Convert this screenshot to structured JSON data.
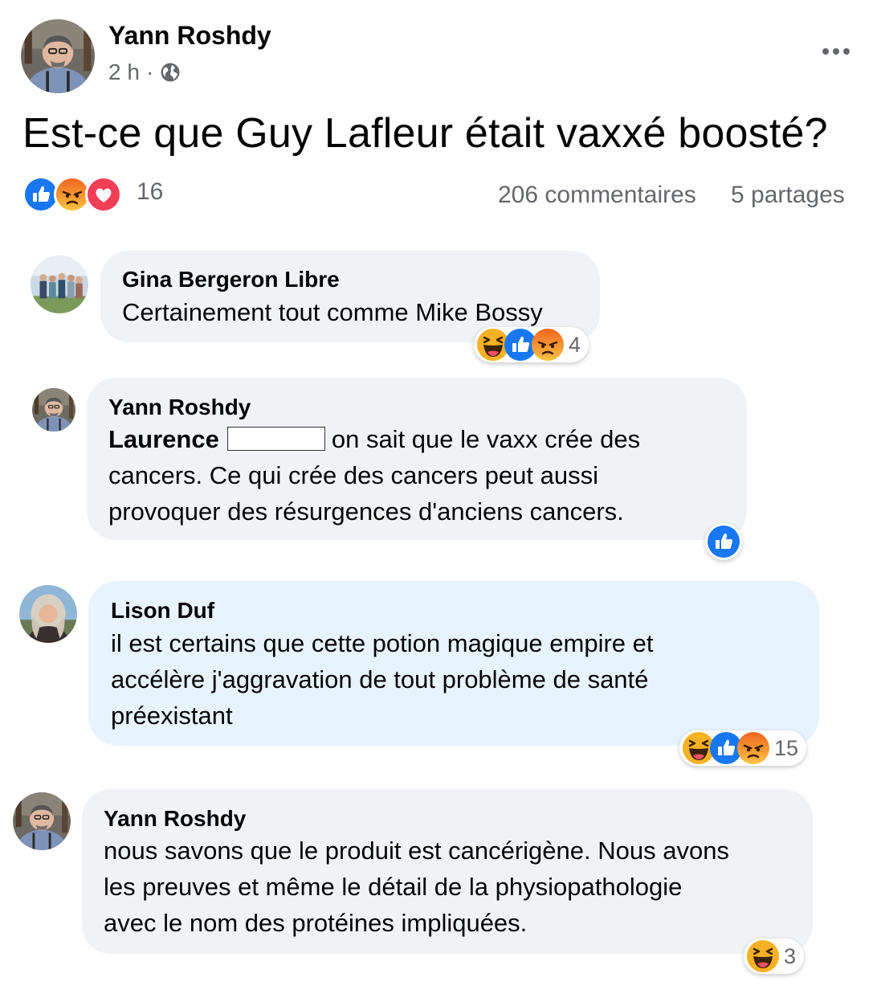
{
  "post": {
    "author": "Yann Roshdy",
    "time": "2 h",
    "separator": "·",
    "text": "Est-ce que Guy Lafleur était vaxxé boosté?",
    "reaction_icons": [
      "like-icon",
      "angry-icon",
      "love-icon"
    ],
    "reaction_count": "16",
    "comments_count": "206 commentaires",
    "shares_count": "5 partages"
  },
  "comments": [
    {
      "author": "Gina Bergeron Libre",
      "lines": [
        "Certainement tout comme Mike Bossy"
      ],
      "reaction_icons": [
        "haha-icon",
        "like-icon",
        "angry-icon"
      ],
      "reaction_count": "4"
    },
    {
      "author": "Yann Roshdy",
      "mention": "Laurence",
      "lines": [
        "on sait que le vaxx crée des",
        "cancers. Ce qui crée des cancers peut aussi",
        "provoquer des résurgences d'anciens cancers."
      ],
      "reaction_icons": [
        "like-icon"
      ]
    },
    {
      "author": "Lison Duf",
      "lines": [
        "il est certains que cette potion magique empire et",
        "accélère j'aggravation de tout problème de santé",
        "préexistant"
      ],
      "reaction_icons": [
        "haha-icon",
        "like-icon",
        "angry-icon"
      ],
      "reaction_count": "15"
    },
    {
      "author": "Yann Roshdy",
      "lines": [
        "nous savons que le produit est cancérigène. Nous avons",
        "les preuves et même le détail de la physiopathologie",
        "avec le nom des protéines impliquées."
      ],
      "reaction_icons": [
        "haha-icon"
      ],
      "reaction_count": "3"
    }
  ],
  "colors": {
    "like": "#1877f2",
    "angry": "#f0641e",
    "love": "#f33e58",
    "haha": "#f7b125",
    "bubble": "#f0f2f5",
    "bubble_highlight": "#e7f3ff",
    "secondary_text": "#65676b"
  }
}
